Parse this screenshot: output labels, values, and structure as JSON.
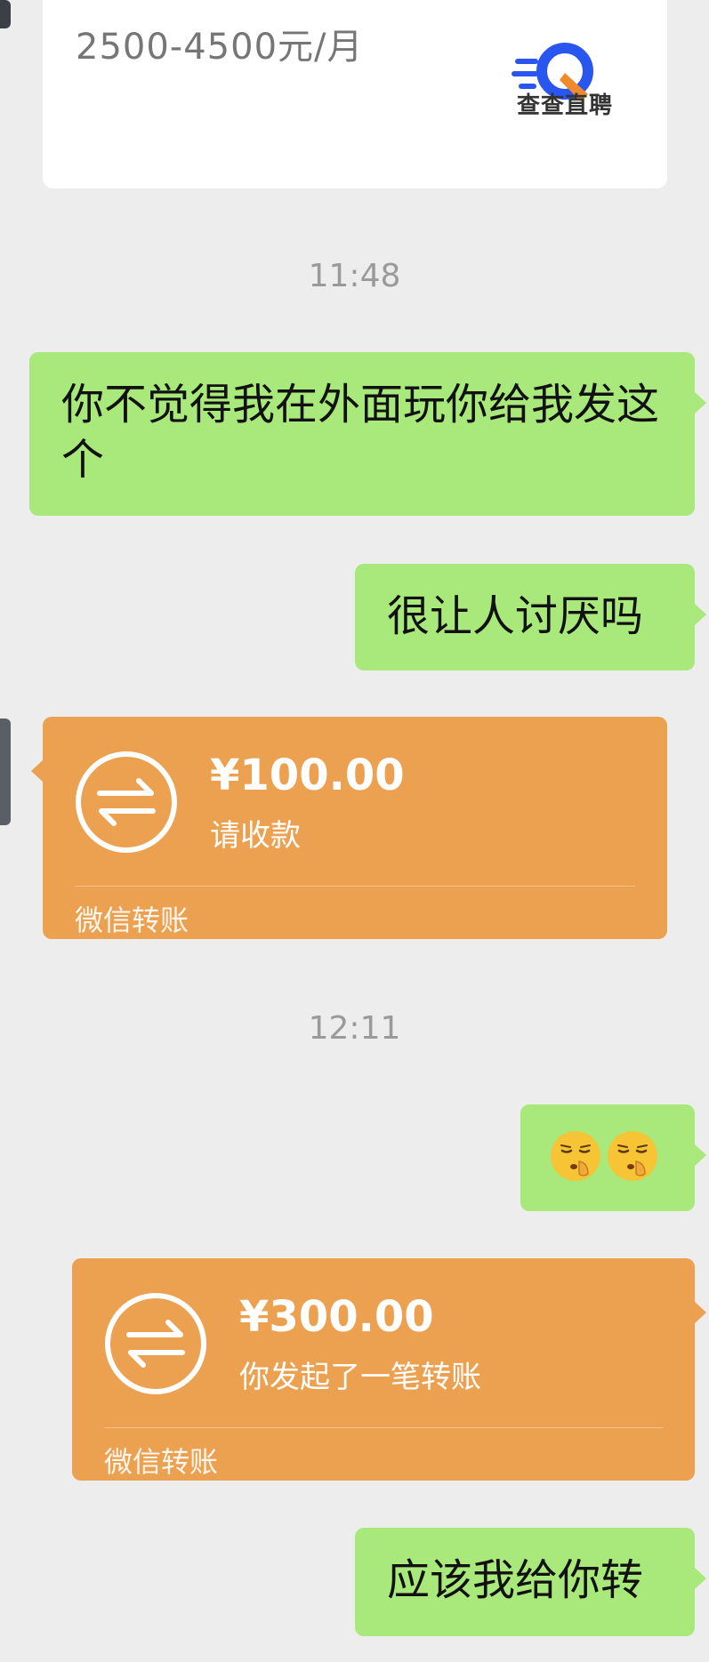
{
  "job_card": {
    "salary": "2500-4500元/月",
    "logo_text": "查查直聘",
    "logo_icon": "search-q-icon"
  },
  "timestamps": [
    "11:48",
    "12:11"
  ],
  "messages": {
    "msg1": "你不觉得我在外面玩你给我发这个",
    "msg2": "很让人讨厌吗",
    "msg3_emoji": [
      "shushing-face-emoji",
      "shushing-face-emoji"
    ],
    "msg4": "应该我给你转"
  },
  "transfers": [
    {
      "amount": "¥100.00",
      "status": "请收款",
      "footer": "微信转账",
      "icon": "transfer-arrows-icon"
    },
    {
      "amount": "¥300.00",
      "status": "你发起了一笔转账",
      "footer": "微信转账",
      "icon": "transfer-arrows-icon"
    }
  ],
  "colors": {
    "background": "#ededed",
    "green_bubble": "#a9e87a",
    "transfer_card": "#eba150",
    "timestamp": "#9a9a9a"
  }
}
